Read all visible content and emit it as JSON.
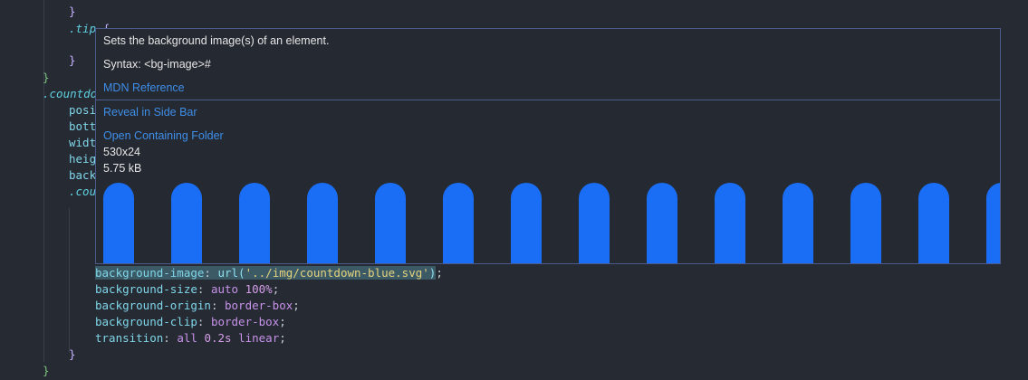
{
  "code": {
    "top_brace": "}",
    "tip_selector": ".tip",
    "tip_open": " {",
    "tip_close": "}",
    "outer_close_1": "}",
    "countdown_selector": ".countdo",
    "partial_props": [
      "posi",
      "bott",
      "widt",
      "heig",
      "back"
    ],
    "partial_sub_selector": ".cou",
    "declarations": [
      {
        "prop": "background-image",
        "value_fn": "url(",
        "value_str": "'../img/countdown-blue.svg'",
        "value_end": ")"
      },
      {
        "prop": "background-size",
        "value_kw": "auto",
        "value_num": "100%"
      },
      {
        "prop": "background-origin",
        "value_kw": "border-box"
      },
      {
        "prop": "background-clip",
        "value_kw": "border-box"
      },
      {
        "prop": "transition",
        "value_kw": "all",
        "value_num": "0.2s",
        "value_kw2": "linear"
      }
    ],
    "inner_close": "}",
    "outer_close_2": "}"
  },
  "hover": {
    "description": "Sets the background image(s) of an element.",
    "syntax": "Syntax: <bg-image>#",
    "mdn_link": "MDN Reference",
    "reveal_link": "Reveal in Side Bar",
    "open_folder_link": "Open Containing Folder",
    "dimensions": "530x24",
    "file_size": "5.75 kB",
    "preview_color": "#1a6ef5",
    "preview_pill_count": 14
  }
}
